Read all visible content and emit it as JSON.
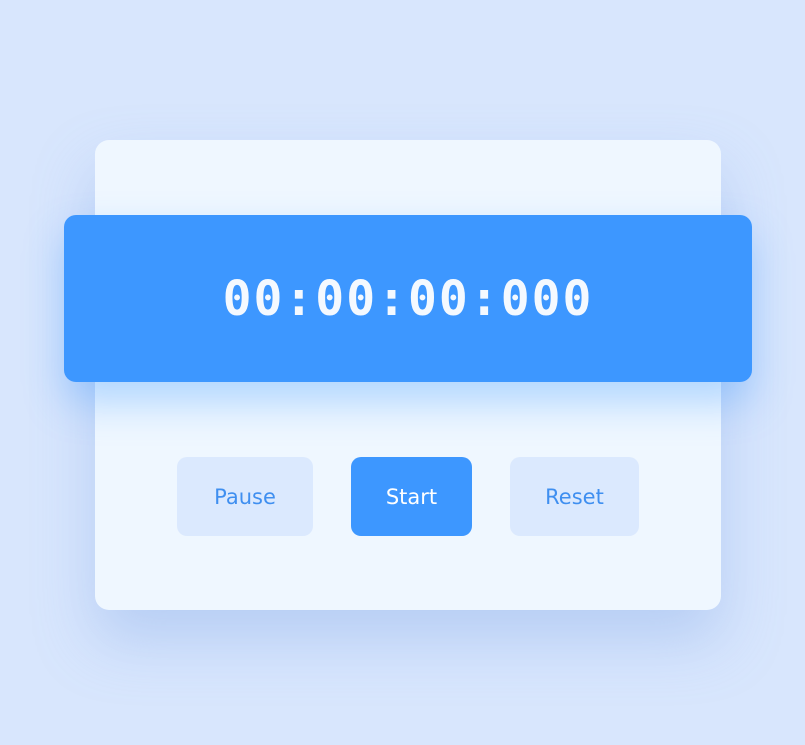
{
  "stopwatch": {
    "time_display": "00:00:00:000"
  },
  "controls": {
    "pause_label": "Pause",
    "start_label": "Start",
    "reset_label": "Reset"
  },
  "colors": {
    "background": "#d8e6fd",
    "card": "#eff7ff",
    "accent": "#3d97ff",
    "secondary_button": "#dbe9fe",
    "secondary_text": "#3f8ff0"
  }
}
